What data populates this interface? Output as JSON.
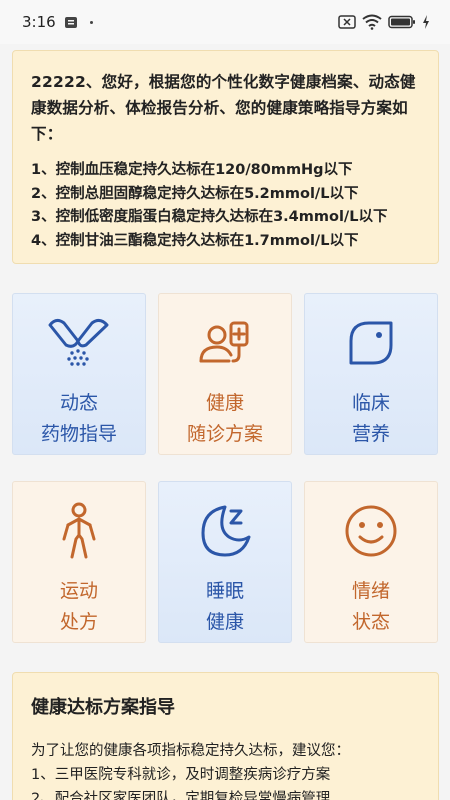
{
  "status_bar": {
    "time": "3:16"
  },
  "summary": {
    "intro": "22222、您好，根据您的个性化数字健康档案、动态健康数据分析、体检报告分析、您的健康策略指导方案如下：",
    "goals": [
      "1、控制血压稳定持久达标在120/80mmHg以下",
      "2、控制总胆固醇稳定持久达标在5.2mmol/L以下",
      "3、控制低密度脂蛋白稳定持久达标在3.4mmol/L以下",
      "4、控制甘油三酯稳定持久达标在1.7mmol/L以下"
    ]
  },
  "tiles": [
    {
      "line1": "动态",
      "line2": "药物指导",
      "icon": "capsule-icon"
    },
    {
      "line1": "健康",
      "line2": "随诊方案",
      "icon": "doctor-plus-icon"
    },
    {
      "line1": "临床",
      "line2": "营养",
      "icon": "leaf-icon"
    },
    {
      "line1": "运动",
      "line2": "处方",
      "icon": "person-exercise-icon"
    },
    {
      "line1": "睡眠",
      "line2": "健康",
      "icon": "moon-sleep-icon"
    },
    {
      "line1": "情绪",
      "line2": "状态",
      "icon": "smiley-icon"
    }
  ],
  "colors": {
    "blue_accent": "#2b56a8",
    "orange_accent": "#c2672d",
    "card_bg": "#fdf1d4"
  },
  "guide": {
    "title": "健康达标方案指导",
    "intro": "为了让您的健康各项指标稳定持久达标，建议您：",
    "items": [
      "1、三甲医院专科就诊，及时调整疾病诊疗方案",
      "2、配合社区家医团队，定期复检异常慢病管理"
    ]
  }
}
